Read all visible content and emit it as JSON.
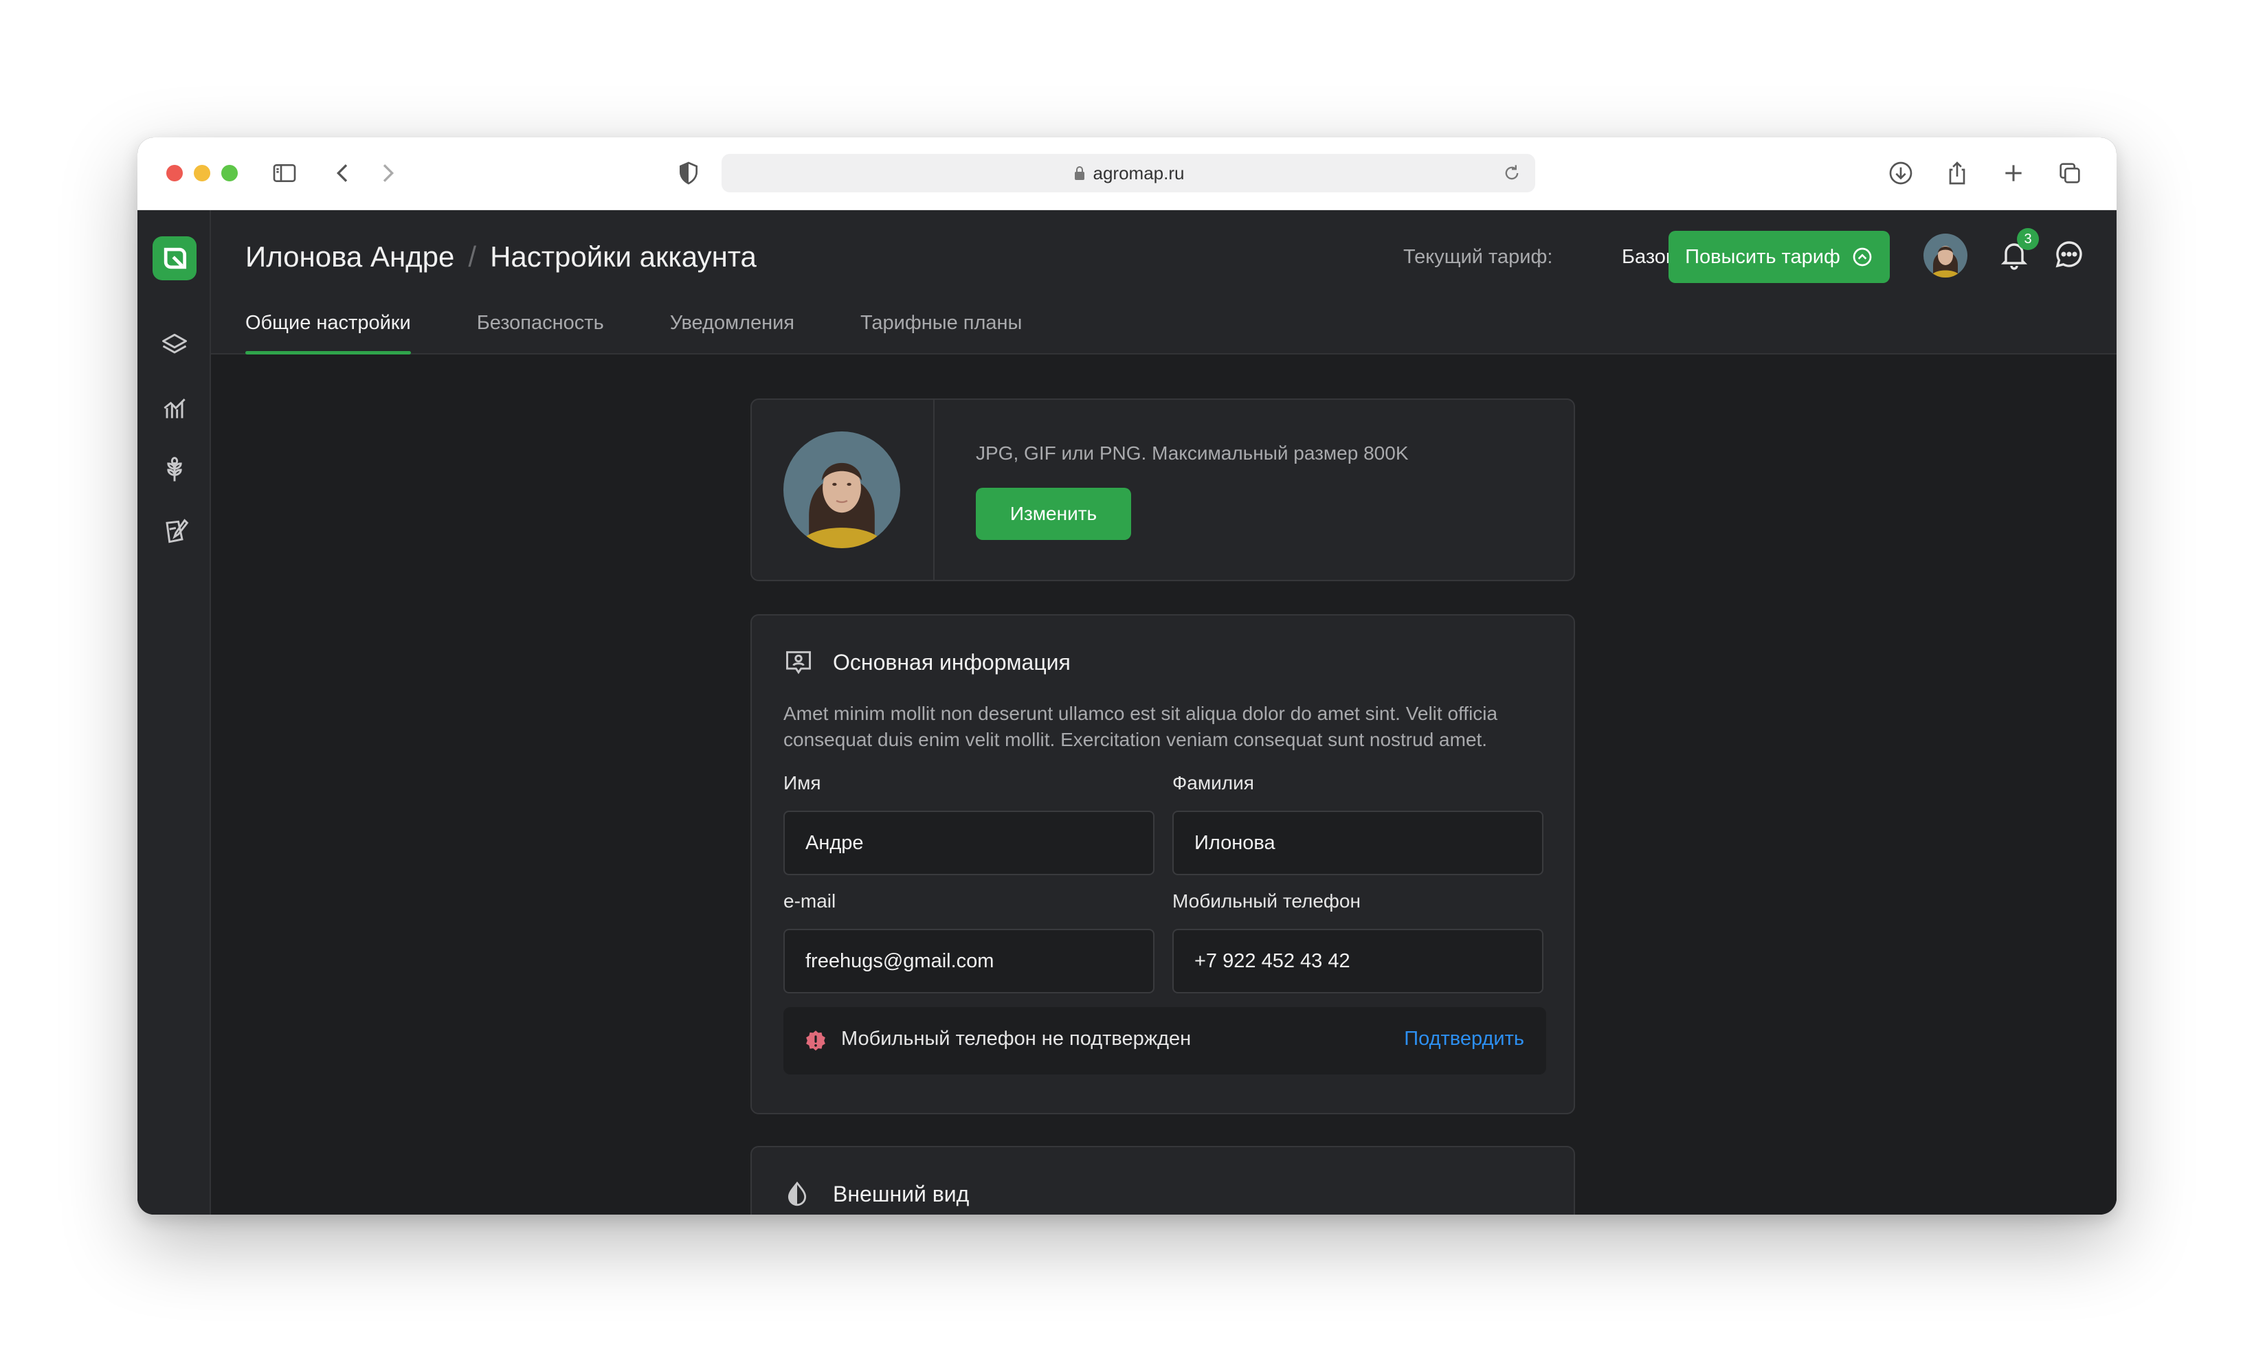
{
  "browser": {
    "url": "agromap.ru"
  },
  "header": {
    "breadcrumb_user": "Илонова Андре",
    "breadcrumb_separator": "/",
    "breadcrumb_page": "Настройки аккаунта",
    "tariff_label": "Текущий тариф:",
    "tariff_value": "Базовый",
    "upgrade_label": "Повысить тариф",
    "notifications_count": "3"
  },
  "tabs": [
    {
      "label": "Общие настройки",
      "active": true
    },
    {
      "label": "Безопасность",
      "active": false
    },
    {
      "label": "Уведомления",
      "active": false
    },
    {
      "label": "Тарифные планы",
      "active": false
    }
  ],
  "photo": {
    "hint": "JPG, GIF или PNG. Максимальный размер 800K",
    "change_label": "Изменить"
  },
  "info": {
    "title": "Основная информация",
    "description": "Amet minim mollit non deserunt ullamco est sit aliqua dolor do amet sint. Velit officia consequat duis enim velit mollit. Exercitation veniam consequat sunt nostrud amet.",
    "first_name_label": "Имя",
    "first_name_value": "Андре",
    "last_name_label": "Фамилия",
    "last_name_value": "Илонова",
    "email_label": "e-mail",
    "email_value": "freehugs@gmail.com",
    "phone_label": "Мобильный телефон",
    "phone_value": "+7 922 452 43 42",
    "notice_text": "Мобильный телефон не подтвержден",
    "notice_link": "Подтвердить"
  },
  "appearance": {
    "title": "Внешний вид"
  },
  "colors": {
    "accent": "#2fa44b",
    "link": "#2d8ff0",
    "warning": "#e06a7a"
  }
}
